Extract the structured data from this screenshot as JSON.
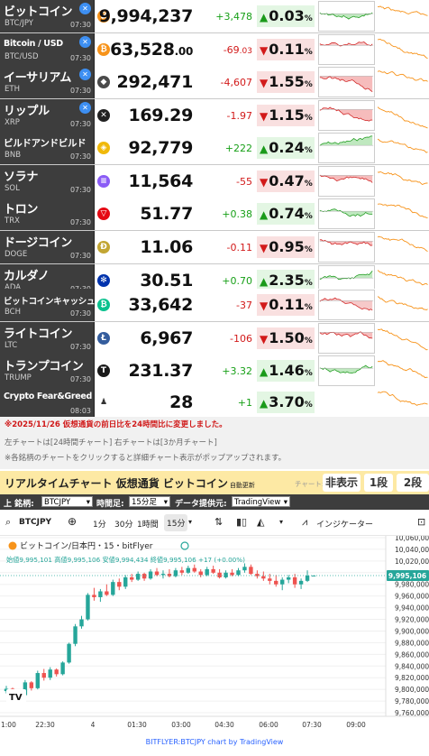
{
  "colors": {
    "up": "#18a018",
    "down": "#d21a1a",
    "name_bg": "#3d3d3d",
    "banner_bg": "#fde9a4",
    "orange_line": "#f7931a"
  },
  "ticker": [
    {
      "name": "ビットコイン",
      "symbol": "BTC/JPY",
      "time": "07:30",
      "icon": "bitcoin-icon",
      "icon_char": "₿",
      "icon_color": "#f7931a",
      "x_badge": true,
      "price": "9,994,237",
      "price_dec": "",
      "change": "+3,478",
      "change_dec": "",
      "direction": "up",
      "pct": "0.03",
      "mini_trend": "up"
    },
    {
      "name": "Bitcoin / USD",
      "symbol": "BTC/USD",
      "time": "07:30",
      "icon": "bitcoin-icon",
      "icon_char": "₿",
      "icon_color": "#f7931a",
      "x_badge": true,
      "price": "63,528",
      "price_dec": ".00",
      "change": "-69",
      "change_dec": ".03",
      "direction": "down",
      "pct": "0.11",
      "mini_trend": "mixed"
    },
    {
      "name": "イーサリアム",
      "symbol": "ETH",
      "time": "07:30",
      "icon": "ethereum-icon",
      "icon_char": "◆",
      "icon_color": "#4a4a4a",
      "x_badge": true,
      "price": "292,471",
      "price_dec": "",
      "change": "-4,607",
      "change_dec": "",
      "direction": "down",
      "pct": "1.55",
      "mini_trend": "down"
    },
    {
      "name": "リップル",
      "symbol": "XRP",
      "time": "07:30",
      "icon": "xrp-icon",
      "icon_char": "✕",
      "icon_color": "#222",
      "x_badge": true,
      "price": "169.29",
      "price_dec": "",
      "change": "-1.97",
      "change_dec": "",
      "direction": "down",
      "pct": "1.15",
      "mini_trend": "down"
    },
    {
      "name": "ビルドアンドビルド",
      "symbol": "BNB",
      "time": "07:30",
      "icon": "bnb-icon",
      "icon_char": "◈",
      "icon_color": "#f0b90b",
      "x_badge": false,
      "price": "92,779",
      "price_dec": "",
      "change": "+222",
      "change_dec": "",
      "direction": "up",
      "pct": "0.24",
      "mini_trend": "up"
    },
    {
      "name": "ソラナ",
      "symbol": "SOL",
      "time": "07:30",
      "icon": "solana-icon",
      "icon_char": "≡",
      "icon_color": "#8b5cf6",
      "x_badge": false,
      "price": "11,564",
      "price_dec": "",
      "change": "-55",
      "change_dec": "",
      "direction": "down",
      "pct": "0.47",
      "mini_trend": "down"
    },
    {
      "name": "トロン",
      "symbol": "TRX",
      "time": "07:30",
      "icon": "tron-icon",
      "icon_char": "▽",
      "icon_color": "#e50914",
      "x_badge": false,
      "price": "51.77",
      "price_dec": "",
      "change": "+0.38",
      "change_dec": "",
      "direction": "up",
      "pct": "0.74",
      "mini_trend": "up"
    },
    {
      "name": "ドージコイン",
      "symbol": "DOGE",
      "time": "07:30",
      "icon": "dogecoin-icon",
      "icon_char": "Ð",
      "icon_color": "#c2a633",
      "x_badge": false,
      "price": "11.06",
      "price_dec": "",
      "change": "-0.11",
      "change_dec": "",
      "direction": "down",
      "pct": "0.95",
      "mini_trend": "down"
    },
    {
      "name": "カルダノ",
      "symbol": "ADA",
      "time": "07:30",
      "icon": "cardano-icon",
      "icon_char": "✻",
      "icon_color": "#0033ad",
      "x_badge": false,
      "price": "30.51",
      "price_dec": "",
      "change": "+0.70",
      "change_dec": "",
      "direction": "up",
      "pct": "2.35",
      "mini_trend": "up"
    },
    {
      "name": "ビットコインキャッシュ",
      "symbol": "BCH",
      "time": "07:30",
      "icon": "bitcoin-cash-icon",
      "icon_char": "₿",
      "icon_color": "#0ac18e",
      "x_badge": false,
      "price": "33,642",
      "price_dec": "",
      "change": "-37",
      "change_dec": "",
      "direction": "down",
      "pct": "0.11",
      "mini_trend": "mixed"
    },
    {
      "name": "ライトコイン",
      "symbol": "LTC",
      "time": "07:30",
      "icon": "litecoin-icon",
      "icon_char": "Ł",
      "icon_color": "#345d9d",
      "x_badge": false,
      "price": "6,967",
      "price_dec": "",
      "change": "-106",
      "change_dec": "",
      "direction": "down",
      "pct": "1.50",
      "mini_trend": "down"
    },
    {
      "name": "トランプコイン",
      "symbol": "TRUMP",
      "time": "07:30",
      "icon": "trump-icon",
      "icon_char": "T",
      "icon_color": "#1a1a1a",
      "x_badge": false,
      "price": "231.37",
      "price_dec": "",
      "change": "+3.32",
      "change_dec": "",
      "direction": "up",
      "pct": "1.46",
      "mini_trend": "up"
    },
    {
      "name": "Crypto Fear&Greed Index",
      "symbol": "",
      "time": "08:03",
      "icon": "fear-greed-icon",
      "icon_char": "♟",
      "icon_color": "#ffffff",
      "x_badge": false,
      "price": "28",
      "price_dec": "",
      "change": "+1",
      "change_dec": "",
      "direction": "up",
      "pct": "3.70",
      "mini_trend": "none"
    }
  ],
  "pct_unit": "%",
  "notes": {
    "line1": "※2025/11/26 仮想通貨の前日比を24時間比に変更しました。",
    "line2": "左チャートは[24時間チャート] 右チャートは[3か月チャート]",
    "line3": "※各銘柄のチャートをクリックすると詳細チャート表示がポップアップされます。"
  },
  "realtime": {
    "title": "リアルタイムチャート 仮想通貨 ビットコイン",
    "auto_update": "自動更新",
    "chart_label": "チャート:",
    "hide_btn": "非表示",
    "one_btn": "1段",
    "two_btn": "2段"
  },
  "controls": {
    "symbol_label": "上 銘柄:",
    "symbol_value": "BTCJPY",
    "period_label": "時間足:",
    "period_value": "15分足",
    "provider_label": "データ提供元:",
    "provider_value": "TradingView"
  },
  "tv_toolbar": {
    "symbol": "BTCJPY",
    "tf1": "1分",
    "tf2": "30分",
    "tf3": "1時間",
    "tf_active": "15分",
    "indicators": "インジケーター"
  },
  "tv_chart": {
    "legend_title": "ビットコイン/日本円・15・bitFlyer",
    "ohlc_text": "始値9,995,101 高値9,995,106 安値9,994,434 終値9,995,106 +17 (+0.00%)",
    "last_price": "9,995,106",
    "y_labels": [
      "10,060,000",
      "10,040,000",
      "10,020,000",
      "10,000,000",
      "9,980,000",
      "9,960,000",
      "9,940,000",
      "9,920,000",
      "9,900,000",
      "9,880,000",
      "9,860,000",
      "9,840,000",
      "9,820,000",
      "9,800,000",
      "9,780,000",
      "9,760,000"
    ],
    "x_labels": [
      "1:00",
      "22:30",
      "4",
      "01:30",
      "03:00",
      "04:30",
      "06:00",
      "07:30",
      "09:00"
    ],
    "ohlc": [
      [
        9797000,
        9806000,
        9793000,
        9801000
      ],
      [
        9801000,
        9803000,
        9780000,
        9784000
      ],
      [
        9784000,
        9795000,
        9780000,
        9790000
      ],
      [
        9790000,
        9816000,
        9788000,
        9812000
      ],
      [
        9812000,
        9814000,
        9798000,
        9802000
      ],
      [
        9802000,
        9832000,
        9800000,
        9828000
      ],
      [
        9828000,
        9835000,
        9815000,
        9820000
      ],
      [
        9820000,
        9838000,
        9816000,
        9834000
      ],
      [
        9834000,
        9836000,
        9822000,
        9826000
      ],
      [
        9826000,
        9848000,
        9824000,
        9846000
      ],
      [
        9846000,
        9880000,
        9844000,
        9878000
      ],
      [
        9878000,
        9912000,
        9874000,
        9908000
      ],
      [
        9908000,
        9926000,
        9904000,
        9920000
      ],
      [
        9920000,
        9965000,
        9918000,
        9962000
      ],
      [
        9962000,
        9974000,
        9952000,
        9958000
      ],
      [
        9958000,
        9972000,
        9950000,
        9968000
      ],
      [
        9968000,
        9980000,
        9960000,
        9962000
      ],
      [
        9962000,
        9988000,
        9960000,
        9984000
      ],
      [
        9984000,
        9990000,
        9970000,
        9976000
      ],
      [
        9976000,
        9996000,
        9972000,
        9992000
      ],
      [
        9992000,
        9998000,
        9984000,
        9988000
      ],
      [
        9988000,
        10002000,
        9986000,
        9998000
      ],
      [
        9998000,
        10000000,
        9986000,
        9990000
      ],
      [
        9990000,
        10006000,
        9988000,
        10002000
      ],
      [
        10002000,
        10008000,
        9994000,
        9996000
      ],
      [
        9996000,
        10004000,
        9990000,
        9998000
      ],
      [
        9998000,
        10006000,
        9992000,
        9994000
      ],
      [
        9994000,
        10008000,
        9992000,
        10004000
      ],
      [
        10004000,
        10010000,
        9996000,
        10000000
      ],
      [
        10000000,
        10012000,
        9998000,
        10008000
      ],
      [
        10008000,
        10014000,
        10000000,
        10002000
      ],
      [
        10002000,
        10006000,
        9992000,
        9996000
      ],
      [
        9996000,
        10010000,
        9994000,
        10006000
      ],
      [
        10006000,
        10012000,
        9998000,
        10000000
      ],
      [
        10000000,
        10006000,
        9990000,
        9992000
      ],
      [
        9992000,
        10004000,
        9990000,
        10000000
      ],
      [
        10000000,
        10006000,
        9994000,
        9996000
      ],
      [
        9996000,
        10008000,
        9994000,
        10004000
      ],
      [
        10004000,
        10016000,
        10000000,
        10010000
      ],
      [
        10010000,
        10014000,
        9996000,
        9998000
      ],
      [
        9998000,
        10004000,
        9990000,
        9994000
      ],
      [
        9994000,
        10002000,
        9986000,
        9990000
      ],
      [
        9990000,
        9998000,
        9980000,
        9986000
      ],
      [
        9986000,
        9996000,
        9976000,
        9980000
      ],
      [
        9980000,
        9992000,
        9970000,
        9988000
      ],
      [
        9988000,
        9996000,
        9982000,
        9992000
      ],
      [
        9992000,
        9998000,
        9974000,
        9980000
      ],
      [
        9980000,
        9990000,
        9972000,
        9986000
      ],
      [
        9986000,
        10004000,
        9984000,
        9995000
      ],
      [
        9995101,
        9995106,
        9994434,
        9995106
      ]
    ]
  },
  "footer": "BITFLYER:BTCJPY chart by TradingView"
}
